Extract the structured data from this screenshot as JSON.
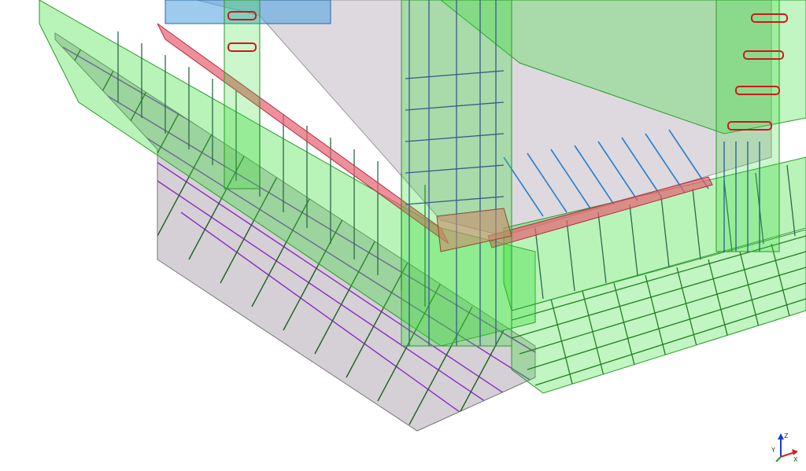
{
  "viewport": {
    "background": "#ffffff",
    "colors": {
      "concrete_green": "#33dd33",
      "concrete_green_edge": "#2a9a2a",
      "lean_grey": "#b0aab4",
      "slab_grey": "#d9d5db",
      "rebar_purple": "#8a2bc0",
      "rebar_dark_green": "#1f5f1f",
      "rebar_blue": "#2a7fc8",
      "stirrup_red": "#cc1a1a",
      "beam_pink": "#e86070",
      "wall_blue": "#4aa0e0"
    }
  },
  "axis_triad": {
    "z": "Z",
    "x": "X",
    "y": "Y"
  }
}
